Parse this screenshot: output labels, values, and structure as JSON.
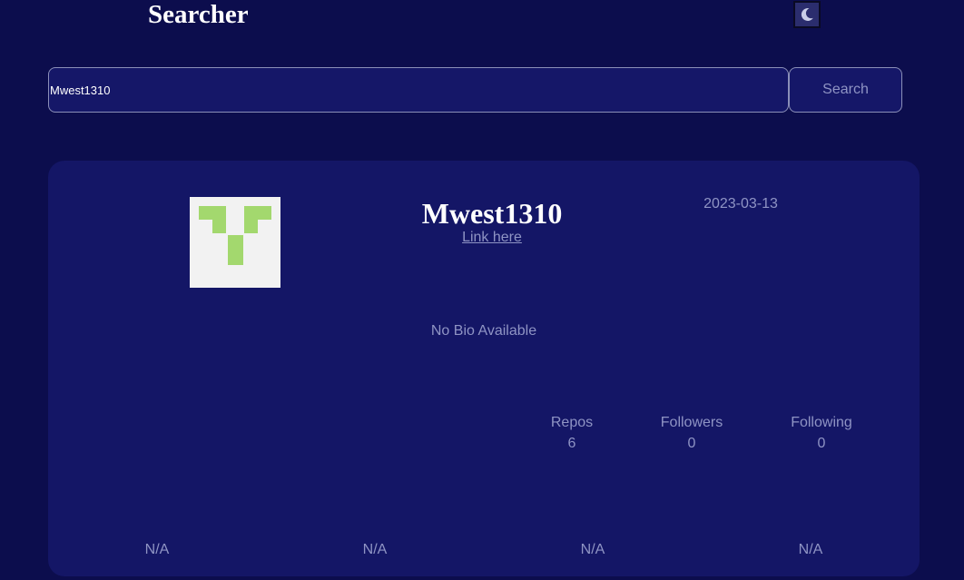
{
  "header": {
    "title": "Searcher",
    "theme_toggle_icon": "moon-icon"
  },
  "search": {
    "value": "Mwest1310",
    "button_label": "Search"
  },
  "profile": {
    "username": "Mwest1310",
    "link_label": "Link here",
    "joined": "2023-03-13",
    "bio": "No Bio Available",
    "stats": [
      {
        "label": "Repos",
        "value": "6"
      },
      {
        "label": "Followers",
        "value": "0"
      },
      {
        "label": "Following",
        "value": "0"
      }
    ],
    "links": [
      "N/A",
      "N/A",
      "N/A",
      "N/A"
    ]
  },
  "colors": {
    "background": "#0c0d4d",
    "card": "#141666",
    "text_muted": "#8f94c4",
    "avatar_accent": "#a3d86e"
  }
}
